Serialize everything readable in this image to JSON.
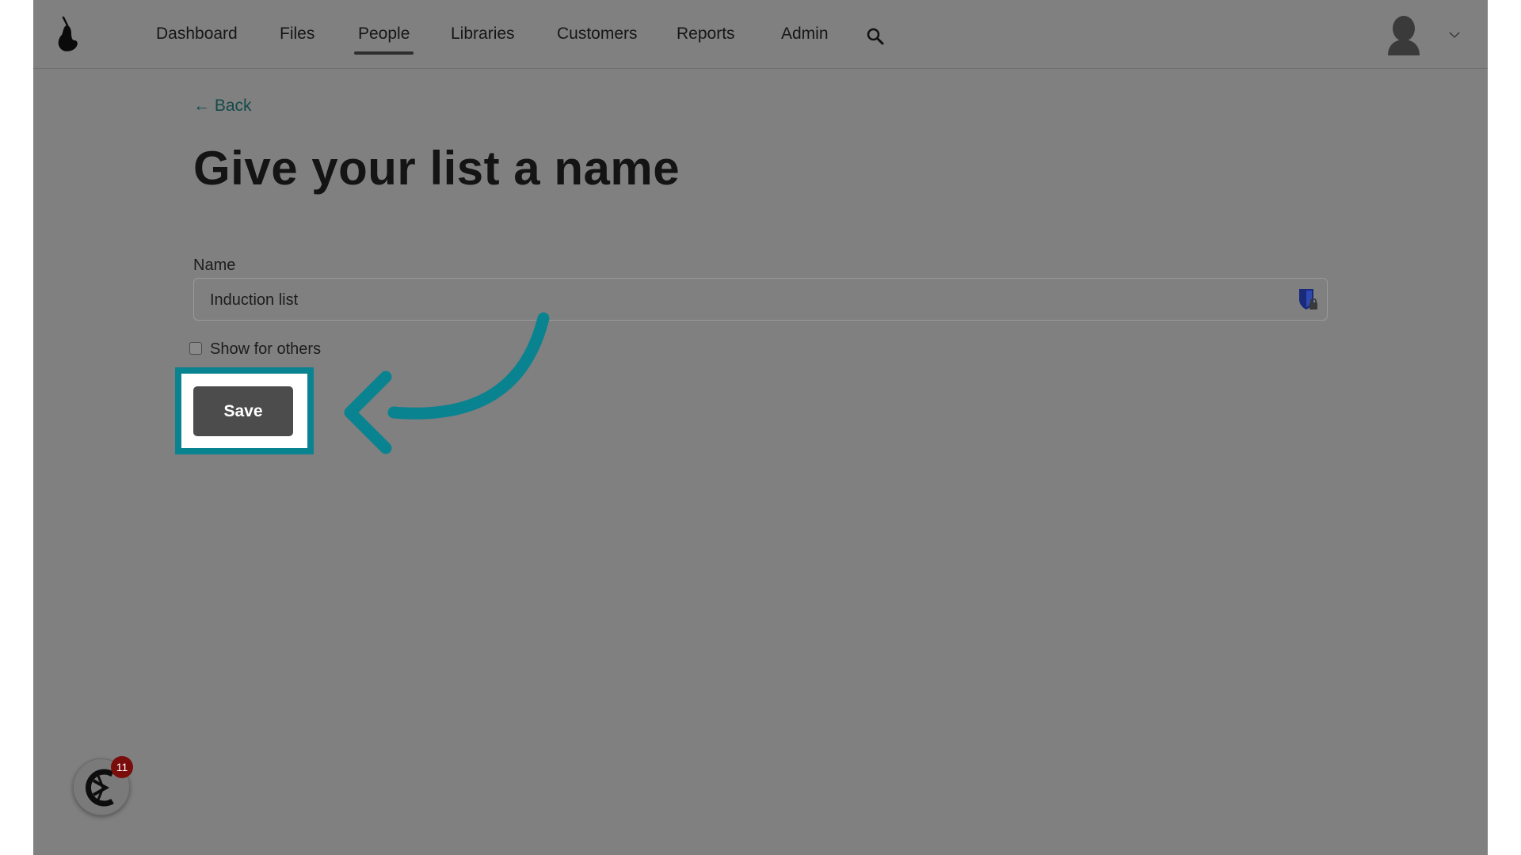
{
  "nav": {
    "items": [
      {
        "label": "Dashboard"
      },
      {
        "label": "Files"
      },
      {
        "label": "People",
        "active": true
      },
      {
        "label": "Libraries"
      },
      {
        "label": "Customers"
      },
      {
        "label": "Reports"
      },
      {
        "label": "Admin"
      }
    ],
    "icons": {
      "logo": "pear-logo-icon",
      "search": "search-icon",
      "avatar": "user-avatar-icon",
      "menu": "chevron-down-icon"
    }
  },
  "main": {
    "back_label": "← Back",
    "title": "Give your list a name",
    "form": {
      "name_label": "Name",
      "name_value": "Induction list",
      "field_icon": "password-manager-icon",
      "checkbox_label": "Show for others",
      "checkbox_checked": false,
      "save_label": "Save"
    }
  },
  "annotation": {
    "highlight_color": "#0a8390",
    "arrow_color": "#0a8390",
    "target": "save-button"
  },
  "widget": {
    "badge_count": "11",
    "icon": "chat-widget-icon"
  },
  "colors": {
    "overlay": "#808080",
    "accent": "#0a8390",
    "button": "#4c4c4c"
  }
}
